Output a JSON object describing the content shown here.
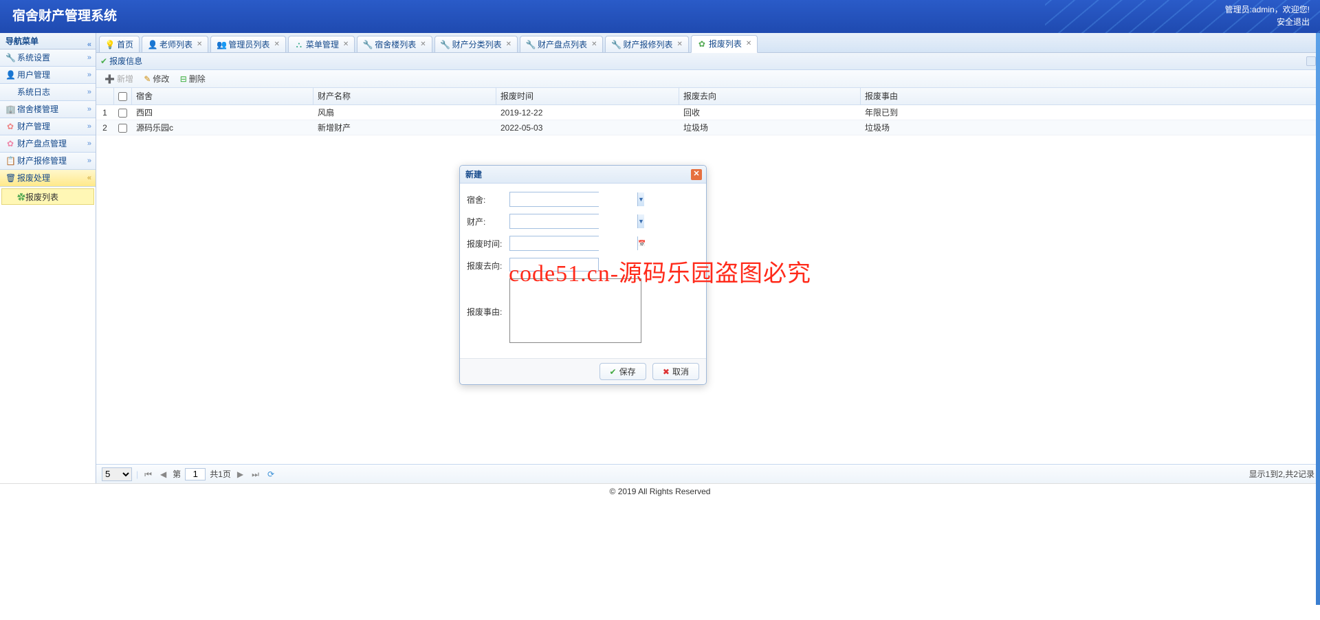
{
  "header": {
    "title": "宿舍财产管理系统",
    "admin_label": "管理员:admin",
    "welcome": "，欢迎您!",
    "logout": "安全退出"
  },
  "sidebar": {
    "title": "导航菜单",
    "items": [
      {
        "label": "系统设置"
      },
      {
        "label": "用户管理"
      },
      {
        "label": "系统日志"
      },
      {
        "label": "宿舍楼管理"
      },
      {
        "label": "财产管理"
      },
      {
        "label": "财产盘点管理"
      },
      {
        "label": "财产报修管理"
      },
      {
        "label": "报废处理"
      }
    ],
    "tree_item": "报废列表"
  },
  "tabs": [
    {
      "label": "首页",
      "closable": false
    },
    {
      "label": "老师列表",
      "closable": true
    },
    {
      "label": "管理员列表",
      "closable": true
    },
    {
      "label": "菜单管理",
      "closable": true
    },
    {
      "label": "宿舍楼列表",
      "closable": true
    },
    {
      "label": "财产分类列表",
      "closable": true
    },
    {
      "label": "财产盘点列表",
      "closable": true
    },
    {
      "label": "财产报修列表",
      "closable": true
    },
    {
      "label": "报废列表",
      "closable": true,
      "active": true
    }
  ],
  "panel": {
    "title": "报废信息",
    "toolbar": {
      "add": "新增",
      "edit": "修改",
      "del": "删除"
    },
    "columns": [
      "宿舍",
      "财产名称",
      "报废时间",
      "报废去向",
      "报废事由"
    ],
    "rows": [
      {
        "n": "1",
        "dorm": "西四",
        "name": "风扇",
        "time": "2019-12-22",
        "where": "回收",
        "reason": "年限已到"
      },
      {
        "n": "2",
        "dorm": "源码乐园c",
        "name": "新增财产",
        "time": "2022-05-03",
        "where": "垃圾场",
        "reason": "垃圾场"
      }
    ]
  },
  "pager": {
    "size": "5",
    "page": "1",
    "total_pages_prefix": "共",
    "total_pages_suffix": "页",
    "page_label": "第",
    "total_pages": "1",
    "info": "显示1到2,共2记录"
  },
  "dialog": {
    "title": "新建",
    "fields": {
      "dorm": "宿舍:",
      "asset": "财产:",
      "time": "报废时间:",
      "where": "报废去向:",
      "reason": "报废事由:"
    },
    "save": "保存",
    "cancel": "取消"
  },
  "footer": "© 2019 All Rights Reserved",
  "watermark": "code51.cn-源码乐园盗图必究"
}
